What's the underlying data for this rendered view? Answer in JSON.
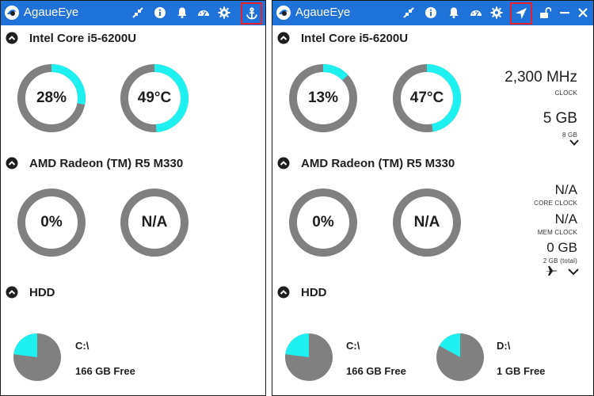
{
  "colors": {
    "titlebar": "#1f73d8",
    "accent": "#1ef0f0",
    "track": "#808080",
    "highlight": "#e8202a"
  },
  "left_window": {
    "title": "AgaueEye",
    "toolbar": [
      "compress-icon",
      "info-icon",
      "bell-icon",
      "dashboard-icon",
      "gear-icon",
      "anchor-icon"
    ],
    "highlighted_button": "anchor-icon",
    "cpu": {
      "name": "Intel Core i5-6200U",
      "usage": "28%",
      "usage_pct": 28,
      "temp": "49°C",
      "temp_pct": 49
    },
    "gpu": {
      "name": "AMD Radeon (TM) R5 M330",
      "usage": "0%",
      "usage_pct": 0,
      "temp": "N/A",
      "temp_pct": 0
    },
    "hdd": {
      "title": "HDD",
      "drives": [
        {
          "label": "C:\\",
          "free": "166 GB Free",
          "used_fraction": 0.77
        }
      ]
    }
  },
  "right_window": {
    "title": "AgaueEye",
    "toolbar": [
      "compress-icon",
      "info-icon",
      "bell-icon",
      "dashboard-icon",
      "gear-icon",
      "location-arrow-icon",
      "unlock-icon",
      "minimize-icon",
      "close-icon"
    ],
    "highlighted_button": "location-arrow-icon",
    "cpu": {
      "name": "Intel Core i5-6200U",
      "usage": "13%",
      "usage_pct": 13,
      "temp": "47°C",
      "temp_pct": 47,
      "clock": "2,300 MHz",
      "clock_label": "CLOCK",
      "memory": "5 GB",
      "memory_total": "8 GB"
    },
    "gpu": {
      "name": "AMD Radeon (TM) R5 M330",
      "usage": "0%",
      "usage_pct": 0,
      "temp": "N/A",
      "temp_pct": 0,
      "core_clock": "N/A",
      "core_clock_label": "CORE CLOCK",
      "mem_clock": "N/A",
      "mem_clock_label": "MEM CLOCK",
      "memory": "0 GB",
      "memory_total": "2 GB (total)"
    },
    "hdd": {
      "title": "HDD",
      "drives": [
        {
          "label": "C:\\",
          "free": "166 GB Free",
          "used_fraction": 0.77
        },
        {
          "label": "D:\\",
          "free": "1 GB Free",
          "used_fraction": 0.83
        }
      ]
    }
  }
}
